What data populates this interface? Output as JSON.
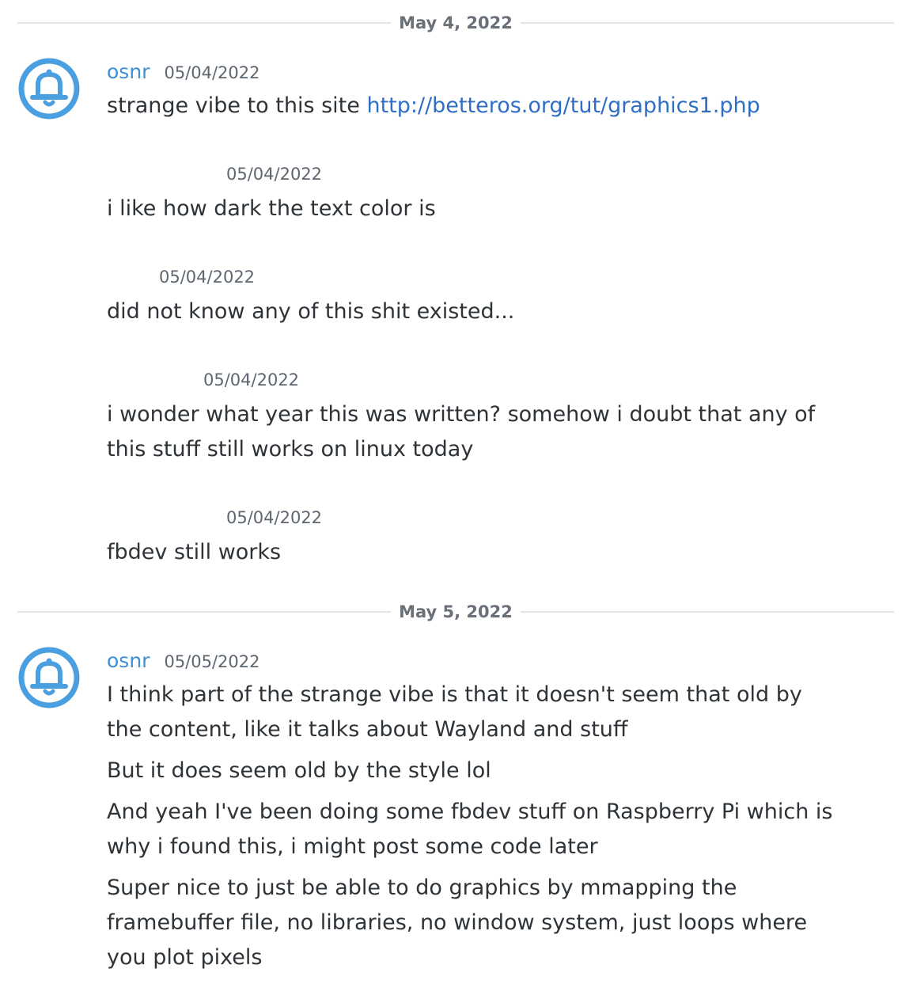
{
  "day1": {
    "date": "May 4, 2022",
    "author": "osnr",
    "author_timestamp": "05/04/2022",
    "messages": [
      {
        "text": "strange vibe to this site ",
        "link": "http://betteros.org/tut/graphics1.php"
      },
      {
        "timestamp": "05/04/2022",
        "text": "i like how dark the text color is"
      },
      {
        "timestamp": "05/04/2022",
        "text": "did not know any of this shit existed..."
      },
      {
        "timestamp": "05/04/2022",
        "text": "i wonder what year this was written? somehow i doubt that any of this stuff still works on linux today"
      },
      {
        "timestamp": "05/04/2022",
        "text": "fbdev still works"
      }
    ]
  },
  "day2": {
    "date": "May 5, 2022",
    "author": "osnr",
    "author_timestamp": "05/05/2022",
    "messages": [
      {
        "text": "I think part of the strange vibe is that it doesn't seem that old by the content, like it talks about Wayland and stuff"
      },
      {
        "text": "But it does seem old by the style lol"
      },
      {
        "text": "And yeah I've been doing some fbdev stuff on Raspberry Pi which is why i found this, i might post some code later"
      },
      {
        "text": "Super nice to just be able to do graphics by mmapping the framebuffer file, no libraries, no window system, just loops where you plot pixels"
      }
    ]
  },
  "icons": {
    "avatar": "bell-icon"
  },
  "colors": {
    "author": "#3d8fd8",
    "link": "#2f6ec4",
    "avatar": "#4a9fe0",
    "divider": "#e3e5e8"
  }
}
